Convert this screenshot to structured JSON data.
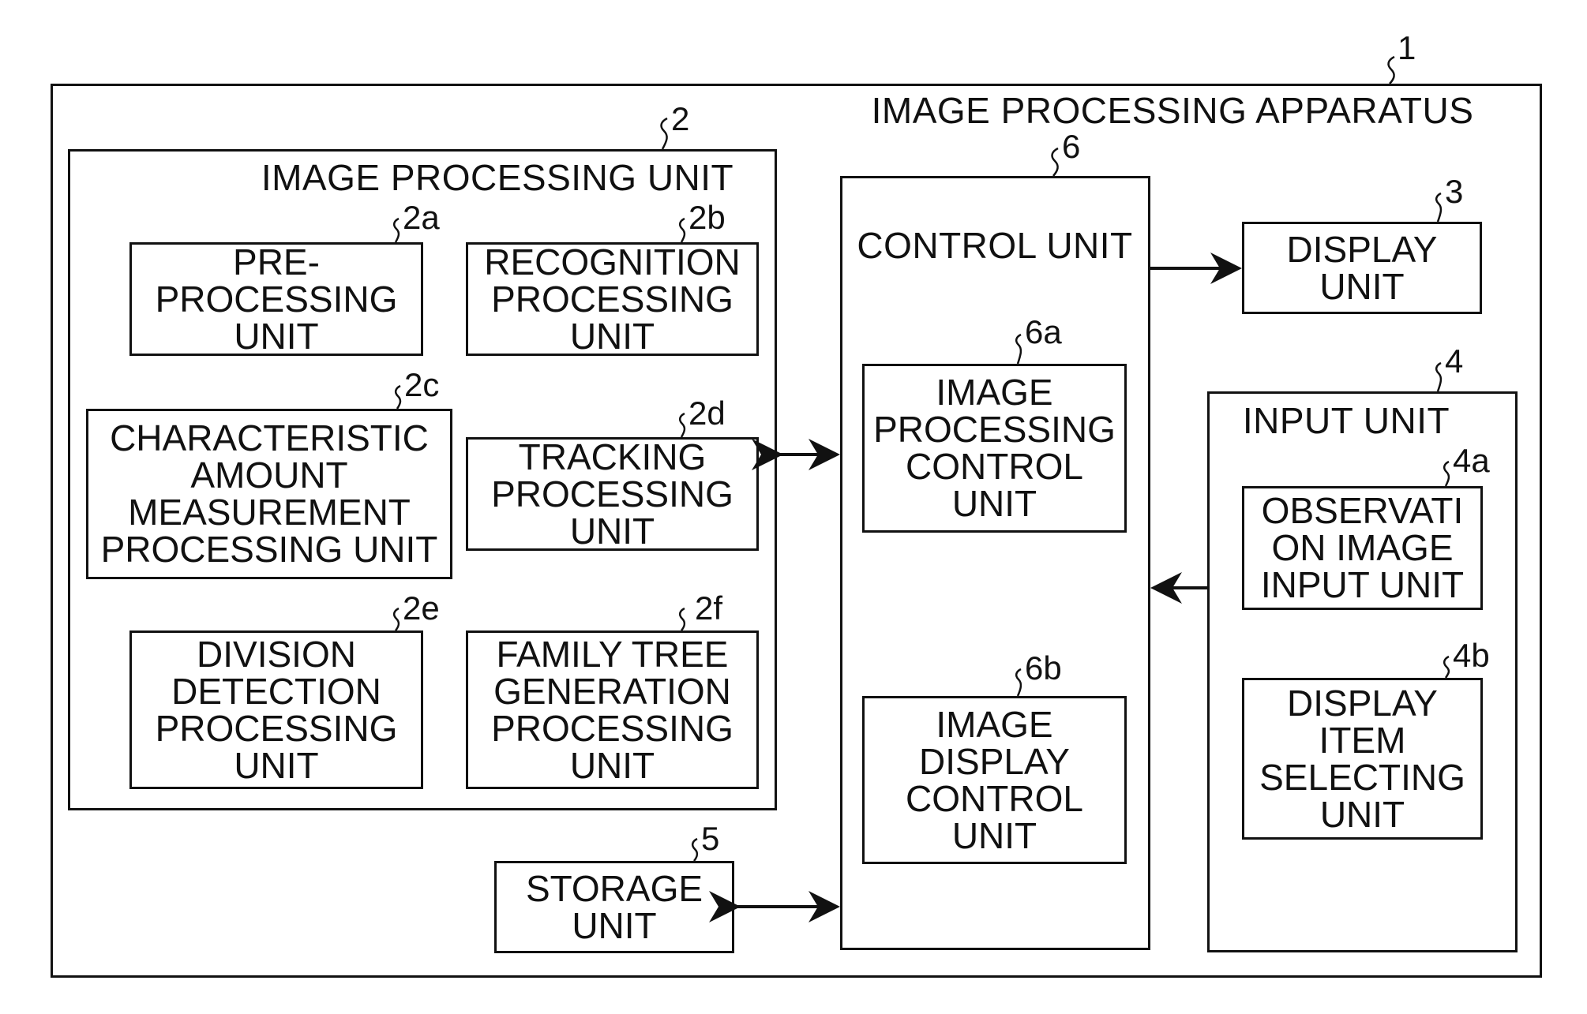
{
  "apparatus": {
    "title": "IMAGE PROCESSING APPARATUS",
    "ref": "1"
  },
  "image_processing_unit": {
    "title": "IMAGE PROCESSING UNIT",
    "ref": "2",
    "blocks": [
      {
        "ref": "2a",
        "label": "PRE-\nPROCESSING\nUNIT"
      },
      {
        "ref": "2b",
        "label": "RECOGNITION\nPROCESSING\nUNIT"
      },
      {
        "ref": "2c",
        "label": "CHARACTERISTIC\nAMOUNT\nMEASUREMENT\nPROCESSING UNIT"
      },
      {
        "ref": "2d",
        "label": "TRACKING\nPROCESSING\nUNIT"
      },
      {
        "ref": "2e",
        "label": "DIVISION\nDETECTION\nPROCESSING\nUNIT"
      },
      {
        "ref": "2f",
        "label": "FAMILY TREE\nGENERATION\nPROCESSING\nUNIT"
      }
    ]
  },
  "control_unit": {
    "title": "CONTROL UNIT",
    "ref": "6",
    "blocks": [
      {
        "ref": "6a",
        "label": "IMAGE\nPROCESSING\nCONTROL\nUNIT"
      },
      {
        "ref": "6b",
        "label": "IMAGE\nDISPLAY\nCONTROL\nUNIT"
      }
    ]
  },
  "display_unit": {
    "ref": "3",
    "label": "DISPLAY\nUNIT"
  },
  "input_unit": {
    "title": "INPUT UNIT",
    "ref": "4",
    "blocks": [
      {
        "ref": "4a",
        "label": "OBSERVATI\nON IMAGE\nINPUT UNIT"
      },
      {
        "ref": "4b",
        "label": "DISPLAY\nITEM\nSELECTING\nUNIT"
      }
    ]
  },
  "storage_unit": {
    "ref": "5",
    "label": "STORAGE\nUNIT"
  }
}
